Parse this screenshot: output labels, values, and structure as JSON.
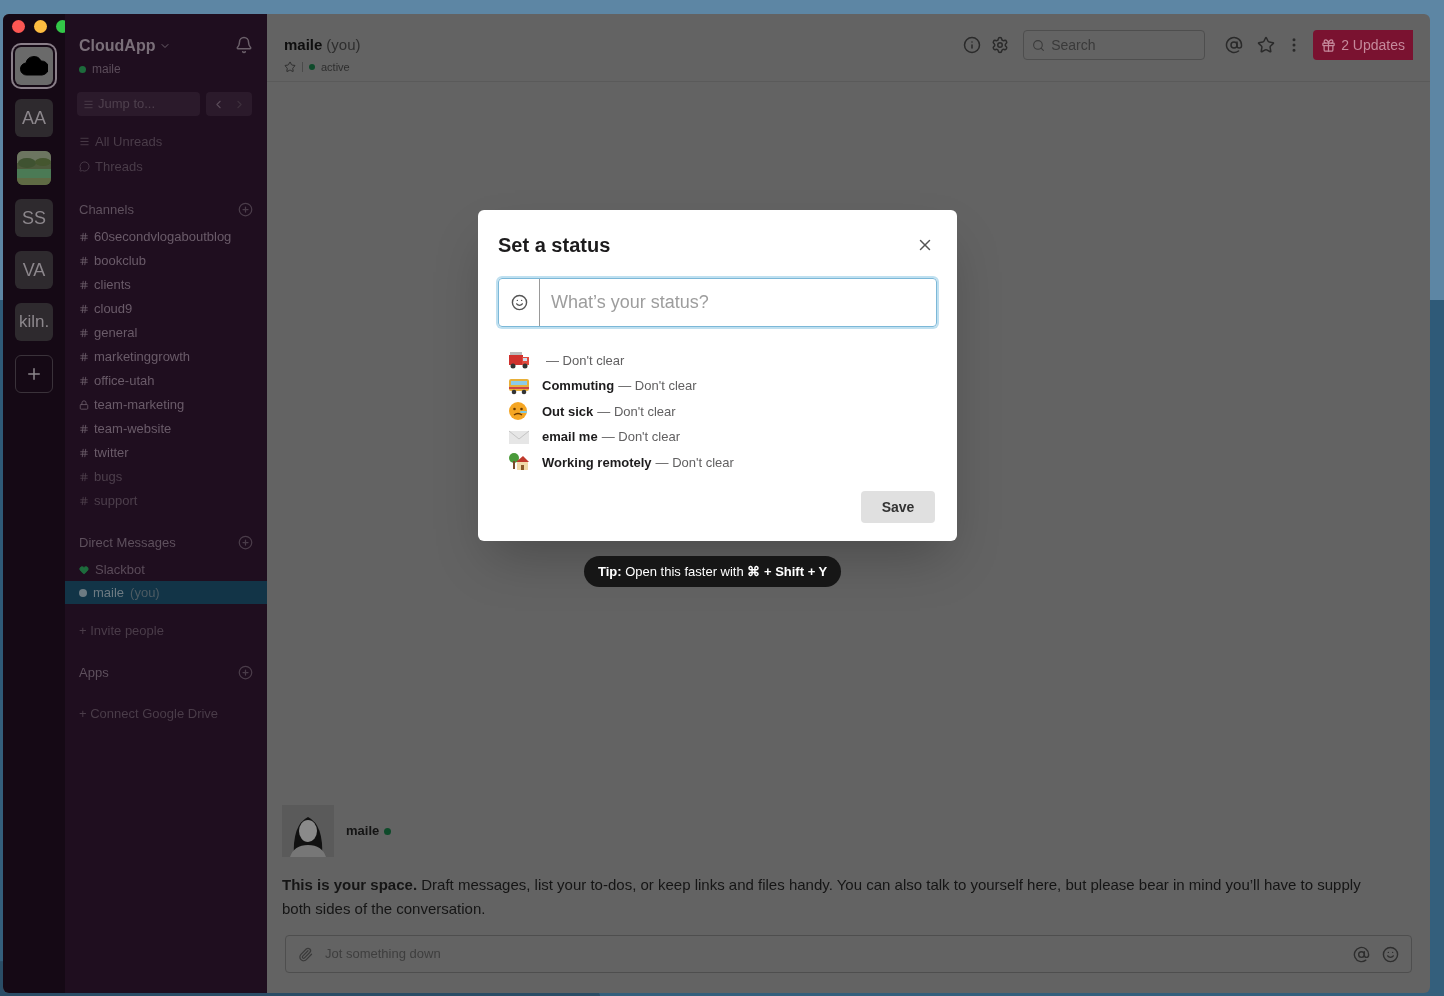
{
  "workspaces": [
    {
      "kind": "logo",
      "selected": true
    },
    {
      "kind": "initials",
      "label": "AA",
      "selected": false
    },
    {
      "kind": "picture",
      "selected": false
    },
    {
      "kind": "initials",
      "label": "SS",
      "selected": false
    },
    {
      "kind": "initials",
      "label": "VA",
      "selected": false
    },
    {
      "kind": "initials",
      "label": "kiln.",
      "selected": false
    },
    {
      "kind": "add",
      "selected": false
    }
  ],
  "sidebar": {
    "workspace_name": "CloudApp",
    "user": "maile",
    "jump_placeholder": "Jump to...",
    "nav": [
      {
        "label": "All Unreads",
        "kind": "unreads"
      },
      {
        "label": "Threads",
        "kind": "threads"
      }
    ],
    "channels_heading": "Channels",
    "channels": [
      {
        "name": "60secondvlogaboutblog",
        "private": false,
        "muted": false
      },
      {
        "name": "bookclub",
        "private": false,
        "muted": false
      },
      {
        "name": "clients",
        "private": false,
        "muted": false
      },
      {
        "name": "cloud9",
        "private": false,
        "muted": false
      },
      {
        "name": "general",
        "private": false,
        "muted": false
      },
      {
        "name": "marketinggrowth",
        "private": false,
        "muted": false
      },
      {
        "name": "office-utah",
        "private": false,
        "muted": false
      },
      {
        "name": "team-marketing",
        "private": true,
        "muted": false
      },
      {
        "name": "team-website",
        "private": false,
        "muted": false
      },
      {
        "name": "twitter",
        "private": false,
        "muted": false
      },
      {
        "name": "bugs",
        "private": false,
        "muted": true
      },
      {
        "name": "support",
        "private": false,
        "muted": true
      }
    ],
    "dm_heading": "Direct Messages",
    "direct_messages": [
      {
        "name": "Slackbot",
        "kind": "bot",
        "selected": false
      },
      {
        "name": "maile",
        "kind": "self",
        "suffix": "(you)",
        "selected": true
      }
    ],
    "invite": "+ Invite people",
    "apps_heading": "Apps",
    "connect": "+ Connect Google Drive"
  },
  "header": {
    "name": "maile",
    "suffix": "(you)",
    "presence": "active",
    "search_placeholder": "Search",
    "updates": "2 Updates"
  },
  "intro": {
    "author": "maile",
    "text": "**This is your space.** Draft messages, list your to-dos, or keep links and files handy. You can also talk to yourself here, but please bear in mind you’ll have to supply both sides of the conversation."
  },
  "composer": {
    "placeholder": "Jot something down"
  },
  "modal": {
    "title": "Set a status",
    "placeholder": "What’s your status?",
    "presets": [
      {
        "duration": "— Don't clear"
      },
      {
        "label": "Commuting",
        "duration": "— Don't clear"
      },
      {
        "label": "Out sick",
        "duration": "— Don't clear"
      },
      {
        "label": "email me",
        "duration": "— Don't clear"
      },
      {
        "label": "Working remotely",
        "duration": "— Don't clear"
      }
    ],
    "save": "Save",
    "tip": "**Tip:** Open this faster with **⌘ + Shift + Y**"
  }
}
